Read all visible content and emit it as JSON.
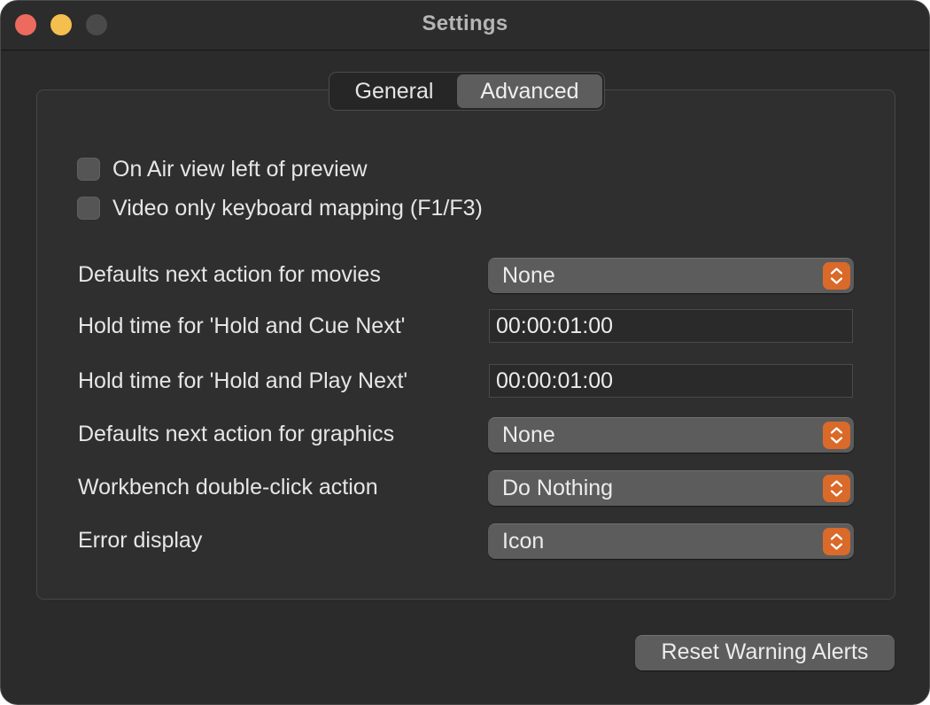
{
  "window": {
    "title": "Settings"
  },
  "tabs": [
    {
      "label": "General",
      "selected": false
    },
    {
      "label": "Advanced",
      "selected": true
    }
  ],
  "checkboxes": [
    {
      "label": "On Air view left of preview",
      "checked": false
    },
    {
      "label": "Video only keyboard mapping (F1/F3)",
      "checked": false
    }
  ],
  "settings": {
    "movies_next_action": {
      "label": "Defaults next action for movies",
      "value": "None"
    },
    "hold_cue_next": {
      "label": "Hold time for 'Hold and Cue Next'",
      "value": "00:00:01:00"
    },
    "hold_play_next": {
      "label": "Hold time for 'Hold and Play Next'",
      "value": "00:00:01:00"
    },
    "graphics_next_action": {
      "label": "Defaults next action for graphics",
      "value": "None"
    },
    "workbench_double_click": {
      "label": "Workbench double-click action",
      "value": "Do Nothing"
    },
    "error_display": {
      "label": "Error display",
      "value": "Icon"
    }
  },
  "buttons": {
    "reset_warning_alerts": "Reset Warning Alerts"
  },
  "colors": {
    "accent": "#d96a29",
    "window_bg": "#2b2b2b",
    "close": "#ed6a5e",
    "minimize": "#f5bf4f"
  },
  "icons": {
    "popup_stepper": "up-down-chevron-icon"
  }
}
